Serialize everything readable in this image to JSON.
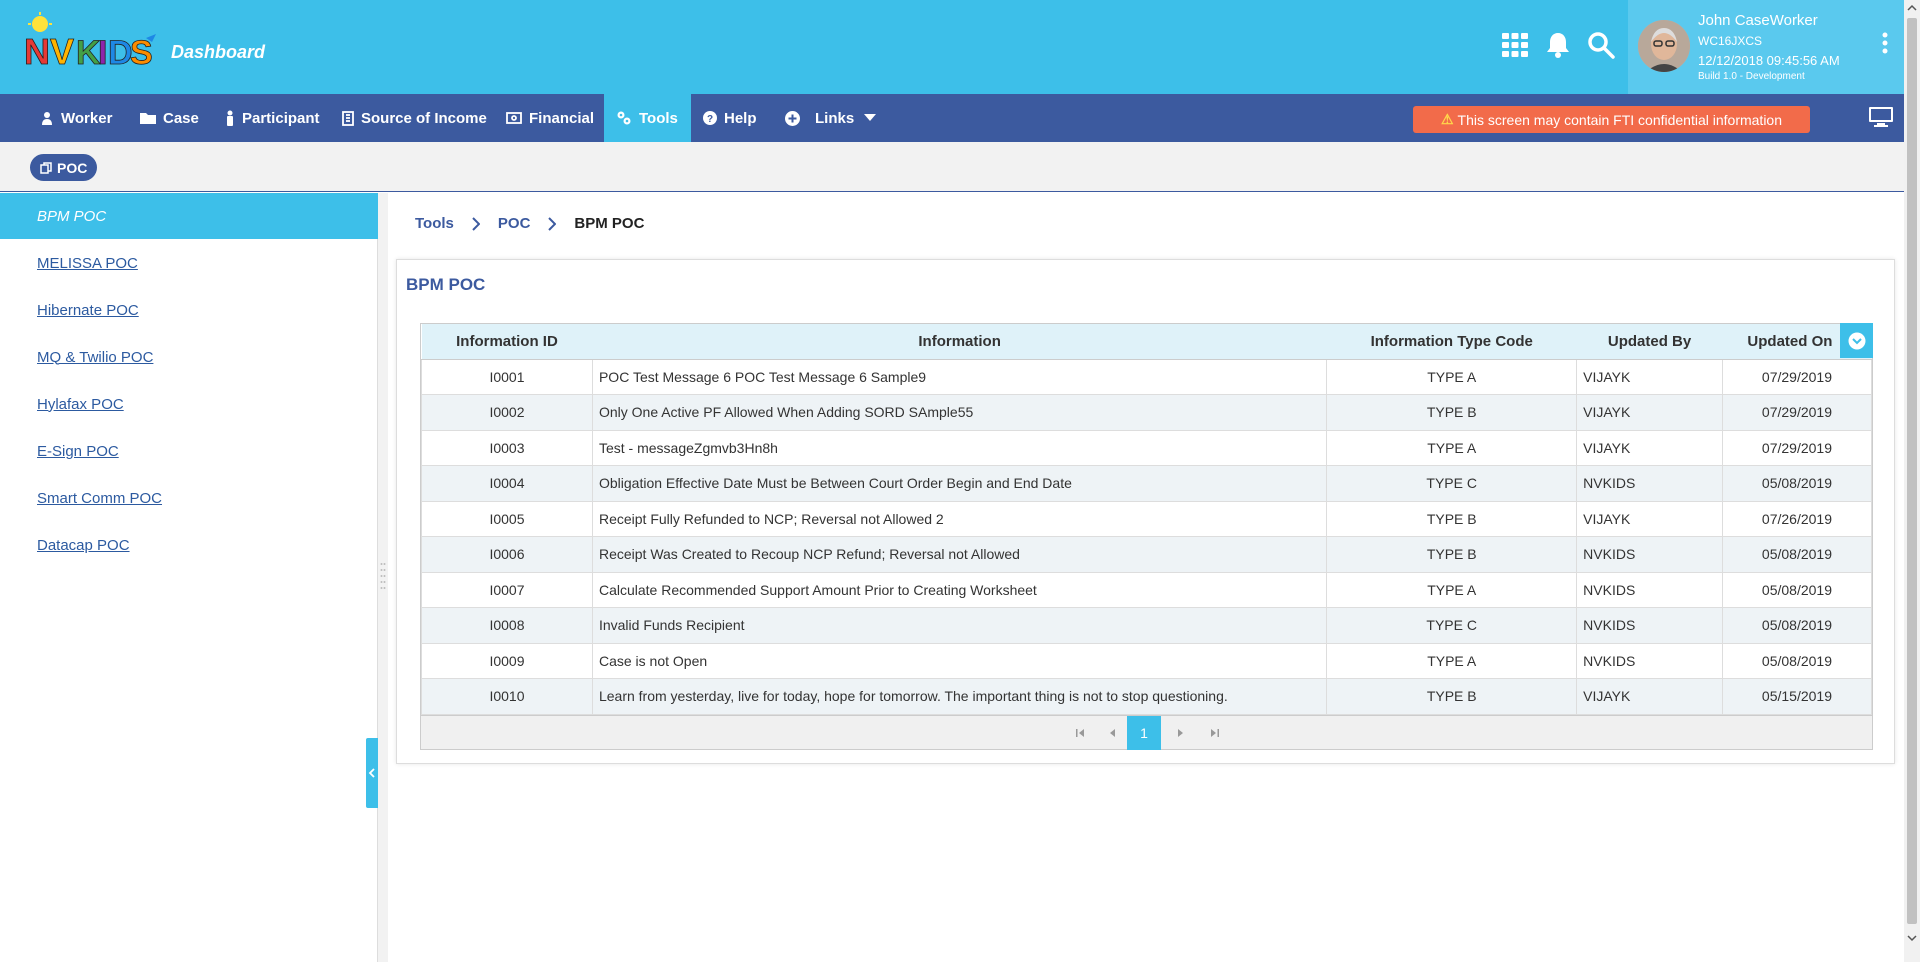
{
  "header": {
    "title": "Dashboard",
    "logo_text": "NVKIDS",
    "user": {
      "name": "John CaseWorker",
      "code": "WC16JXCS",
      "datetime": "12/12/2018 09:45:56 AM",
      "build": "Build 1.0 - Development"
    }
  },
  "nav": {
    "items": [
      {
        "label": "Worker",
        "icon": "user-icon"
      },
      {
        "label": "Case",
        "icon": "folder-icon"
      },
      {
        "label": "Participant",
        "icon": "person-icon"
      },
      {
        "label": "Source of Income",
        "icon": "building-icon"
      },
      {
        "label": "Financial",
        "icon": "money-icon"
      },
      {
        "label": "Tools",
        "icon": "tools-icon",
        "active": true
      },
      {
        "label": "Help",
        "icon": "help-icon"
      },
      {
        "label": "Links",
        "icon": "plus-circle-icon"
      }
    ],
    "fti_warning": "This screen may contain FTI confidential information"
  },
  "subbar": {
    "pill_label": "POC"
  },
  "sidebar": {
    "items": [
      {
        "label": "BPM POC",
        "active": true
      },
      {
        "label": "MELISSA POC"
      },
      {
        "label": "Hibernate POC"
      },
      {
        "label": "MQ & Twilio POC"
      },
      {
        "label": "Hylafax POC"
      },
      {
        "label": "E-Sign POC"
      },
      {
        "label": "Smart Comm POC"
      },
      {
        "label": "Datacap POC"
      }
    ]
  },
  "breadcrumb": {
    "items": [
      "Tools",
      "POC"
    ],
    "current": "BPM POC"
  },
  "panel": {
    "title": "BPM POC",
    "columns": [
      "Information ID",
      "Information",
      "Information Type Code",
      "Updated By",
      "Updated On"
    ],
    "rows": [
      [
        "I0001",
        "POC Test Message 6 POC Test Message 6 Sample9",
        "TYPE A",
        "VIJAYK",
        "07/29/2019"
      ],
      [
        "I0002",
        "Only One Active PF Allowed When Adding SORD SAmple55",
        "TYPE B",
        "VIJAYK",
        "07/29/2019"
      ],
      [
        "I0003",
        "Test - messageZgmvb3Hn8h",
        "TYPE A",
        "VIJAYK",
        "07/29/2019"
      ],
      [
        "I0004",
        "Obligation Effective Date Must be Between Court Order Begin and End Date",
        "TYPE C",
        "NVKIDS",
        "05/08/2019"
      ],
      [
        "I0005",
        "Receipt Fully Refunded to NCP; Reversal not Allowed 2",
        "TYPE B",
        "VIJAYK",
        "07/26/2019"
      ],
      [
        "I0006",
        "Receipt Was Created to Recoup NCP Refund; Reversal not Allowed",
        "TYPE B",
        "NVKIDS",
        "05/08/2019"
      ],
      [
        "I0007",
        "Calculate Recommended Support Amount Prior to Creating Worksheet",
        "TYPE A",
        "NVKIDS",
        "05/08/2019"
      ],
      [
        "I0008",
        "Invalid Funds Recipient",
        "TYPE C",
        "NVKIDS",
        "05/08/2019"
      ],
      [
        "I0009",
        "Case is not Open",
        "TYPE A",
        "NVKIDS",
        "05/08/2019"
      ],
      [
        "I0010",
        "Learn from yesterday, live for today, hope for tomorrow. The important thing is not to stop questioning.",
        "TYPE B",
        "VIJAYK",
        "05/15/2019"
      ]
    ],
    "pager": {
      "current_page": "1"
    }
  },
  "colors": {
    "header": "#3dbfe9",
    "nav": "#3c5a9f",
    "warning": "#f26b4a"
  }
}
